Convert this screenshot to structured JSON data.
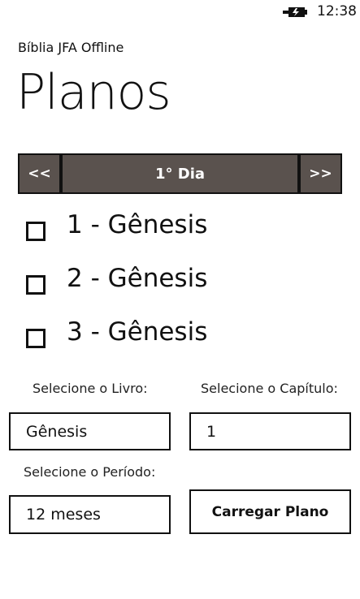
{
  "status_bar": {
    "time": "12:38",
    "battery_icon": "battery-charging-icon"
  },
  "app_title": "Bíblia JFA Offline",
  "page_title": "Planos",
  "day_nav": {
    "prev_label": "<<",
    "day_label": "1° Dia",
    "next_label": ">>"
  },
  "readings": [
    {
      "label": "1 - Gênesis",
      "checked": false
    },
    {
      "label": "2 - Gênesis",
      "checked": false
    },
    {
      "label": "3 - Gênesis",
      "checked": false
    }
  ],
  "form": {
    "book_label": "Selecione o Livro:",
    "book_value": "Gênesis",
    "chapter_label": "Selecione o Capítulo:",
    "chapter_value": "1",
    "period_label": "Selecione o Período:",
    "period_value": "12 meses",
    "load_button": "Carregar Plano"
  },
  "colors": {
    "nav_button_bg": "#5a524e",
    "nav_button_text": "#ffffff",
    "background": "#ffffff"
  }
}
